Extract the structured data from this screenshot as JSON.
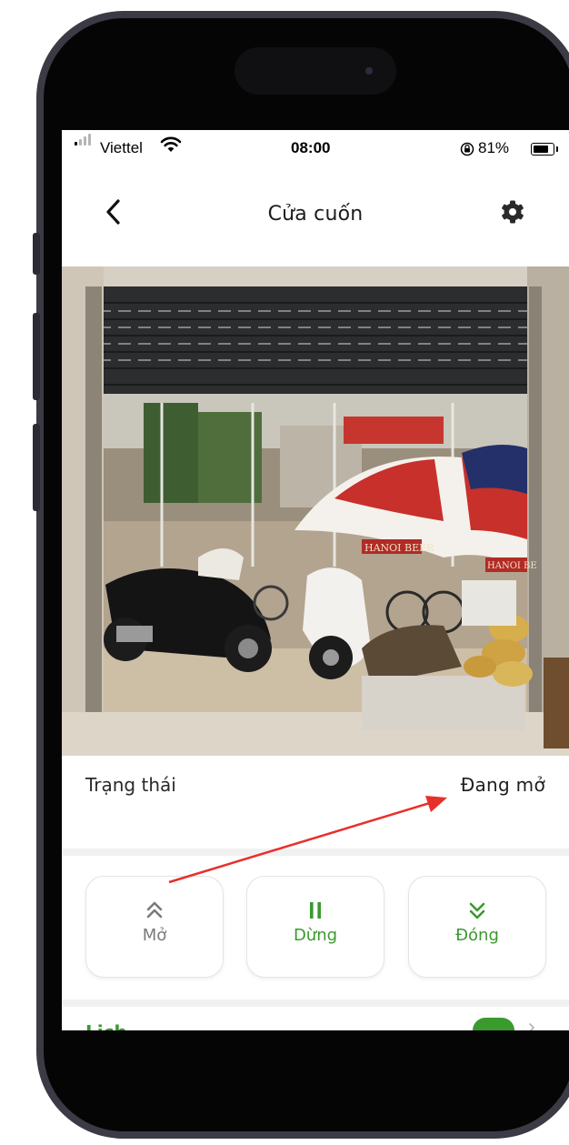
{
  "status_bar": {
    "carrier": "Viettel",
    "time": "08:00",
    "battery": "81%",
    "battery_level": 0.81
  },
  "header": {
    "title": "Cửa cuốn",
    "back_icon": "chevron-left-icon",
    "settings_icon": "gear-icon"
  },
  "device": {
    "status_label": "Trạng thái",
    "status_value": "Đang mở"
  },
  "controls": [
    {
      "label": "Mở",
      "icon": "double-chevron-up-icon",
      "color": "#7a7a7a"
    },
    {
      "label": "Dừng",
      "icon": "pause-icon",
      "color": "#3a9a2e"
    },
    {
      "label": "Đóng",
      "icon": "double-chevron-down-icon",
      "color": "#3a9a2e"
    }
  ],
  "schedule": {
    "label": "Lịch",
    "toggle_on": true
  },
  "photo_signs": [
    "HANOI BEER",
    "HANOI BE"
  ],
  "colors": {
    "accent_green": "#3a9a2e",
    "annotation_red": "#e8302a"
  }
}
